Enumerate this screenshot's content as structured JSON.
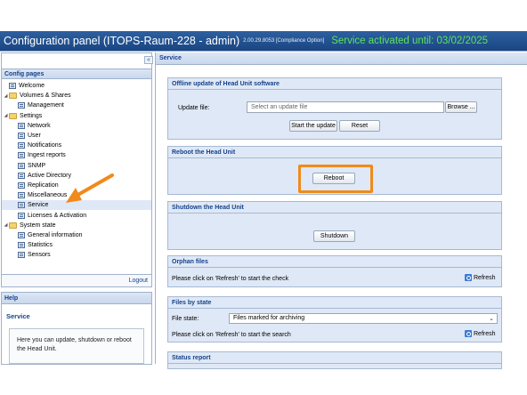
{
  "window": {
    "title": "Configuration panel (ITOPS-Raum-228 - admin)",
    "version": "2.00.29.8053 [Compliance Option]",
    "license_status": "Service activated until: 03/02/2025"
  },
  "sidebar": {
    "heading": "Config pages",
    "collapse_glyph": "«",
    "items": [
      {
        "label": "Welcome",
        "icon": "page-icon"
      },
      {
        "label": "Volumes & Shares",
        "icon": "folder-icon"
      },
      {
        "label": "Management",
        "icon": "page-icon"
      },
      {
        "label": "Settings",
        "icon": "folder-icon"
      },
      {
        "label": "Network",
        "icon": "page-icon"
      },
      {
        "label": "User",
        "icon": "page-icon"
      },
      {
        "label": "Notifications",
        "icon": "page-icon"
      },
      {
        "label": "Ingest reports",
        "icon": "page-icon"
      },
      {
        "label": "SNMP",
        "icon": "page-icon"
      },
      {
        "label": "Active Directory",
        "icon": "page-icon"
      },
      {
        "label": "Replication",
        "icon": "page-icon"
      },
      {
        "label": "Miscellaneous",
        "icon": "page-icon"
      },
      {
        "label": "Service",
        "icon": "page-icon"
      },
      {
        "label": "Licenses & Activation",
        "icon": "page-icon"
      },
      {
        "label": "System state",
        "icon": "folder-icon"
      },
      {
        "label": "General information",
        "icon": "page-icon"
      },
      {
        "label": "Statistics",
        "icon": "page-icon"
      },
      {
        "label": "Sensors",
        "icon": "page-icon"
      }
    ],
    "logout_label": "Logout"
  },
  "help": {
    "heading": "Help",
    "title": "Service",
    "text": "Here you can update, shutdown or reboot the Head Unit."
  },
  "main": {
    "heading": "Service",
    "offline_update": {
      "title": "Offline update of Head Unit software",
      "file_label": "Update file:",
      "file_placeholder": "Select an update file",
      "browse_label": "Browse ...",
      "start_label": "Start the update",
      "reset_label": "Reset"
    },
    "reboot": {
      "title": "Reboot the Head Unit",
      "button_label": "Reboot"
    },
    "shutdown": {
      "title": "Shutdown the Head Unit",
      "button_label": "Shutdown"
    },
    "orphan": {
      "title": "Orphan files",
      "hint": "Please click on 'Refresh' to start the check",
      "refresh_label": "Refresh"
    },
    "files_by_state": {
      "title": "Files by state",
      "state_label": "File state:",
      "state_value": "Files marked for archiving",
      "hint": "Please click on 'Refresh' to start the search",
      "refresh_label": "Refresh"
    },
    "status_report": {
      "title": "Status report"
    }
  },
  "colors": {
    "title_bar": "#1f4f8f",
    "license_text": "#5be35b",
    "highlight": "#f08a1a",
    "panel_header": "#15428b",
    "fieldset_bg": "#dfe8f6"
  }
}
